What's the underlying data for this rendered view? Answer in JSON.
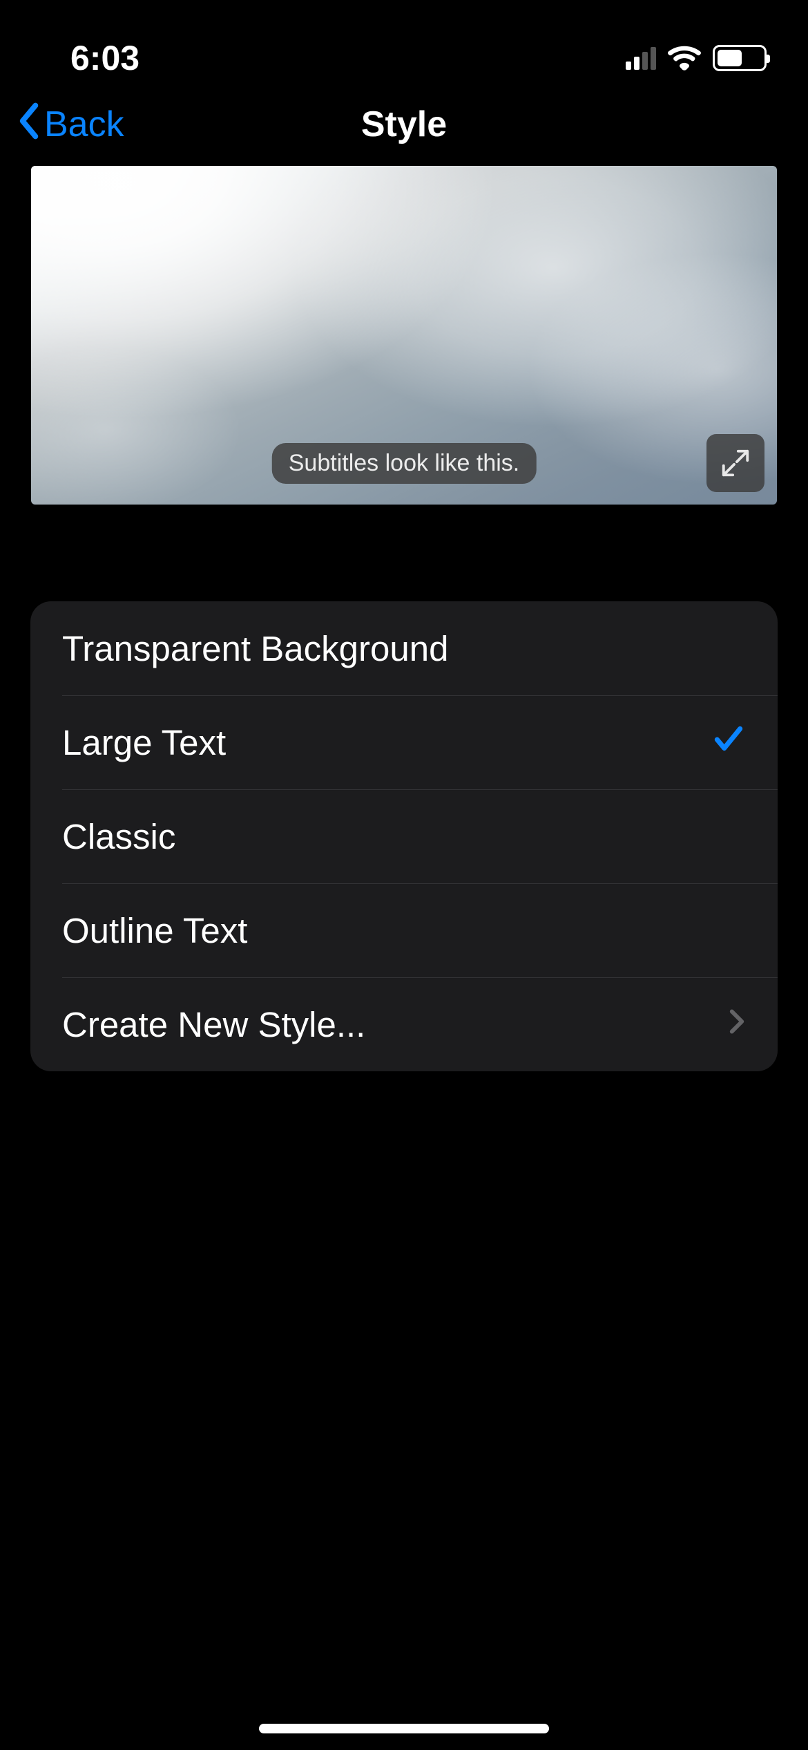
{
  "status_bar": {
    "time": "6:03"
  },
  "nav": {
    "back_label": "Back",
    "title": "Style"
  },
  "preview": {
    "subtitle_text": "Subtitles look like this."
  },
  "styles": {
    "items": [
      {
        "label": "Transparent Background",
        "selected": false,
        "disclosure": false
      },
      {
        "label": "Large Text",
        "selected": true,
        "disclosure": false
      },
      {
        "label": "Classic",
        "selected": false,
        "disclosure": false
      },
      {
        "label": "Outline Text",
        "selected": false,
        "disclosure": false
      },
      {
        "label": "Create New Style...",
        "selected": false,
        "disclosure": true
      }
    ]
  }
}
